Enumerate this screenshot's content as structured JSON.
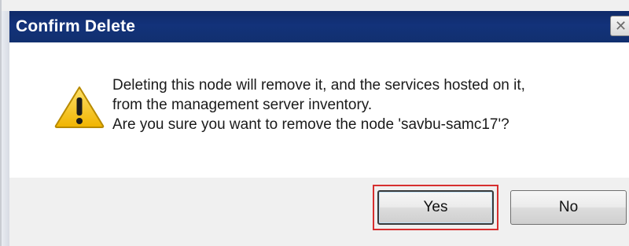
{
  "dialog": {
    "title": "Confirm Delete",
    "close_glyph": "✕",
    "icon": "warning-icon",
    "message_lines": [
      "Deleting this node will remove it, and the services hosted on it,",
      "from the management server inventory.",
      "Are you sure you want to remove the node 'savbu-samc17'?"
    ],
    "buttons": {
      "yes_label": "Yes",
      "no_label": "No"
    },
    "focused_button": "Yes",
    "colors": {
      "titlebar": "#13327a",
      "focus_highlight": "#d62f2f",
      "warning_fill": "#f5c21b"
    }
  }
}
